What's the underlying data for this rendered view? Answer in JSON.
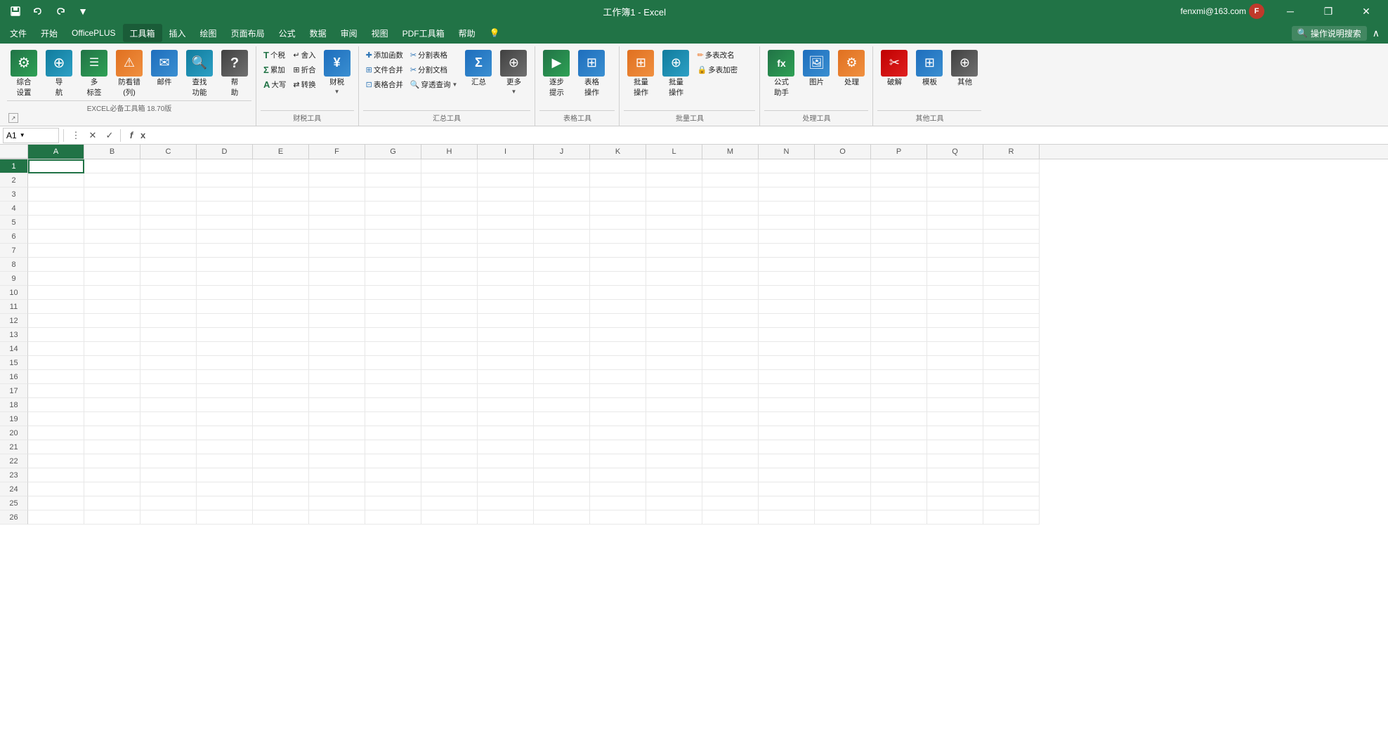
{
  "titleBar": {
    "title": "工作簿1 - Excel",
    "userEmail": "fenxmi@163.com",
    "userInitial": "F",
    "qatButtons": [
      "save",
      "undo",
      "redo",
      "customize"
    ],
    "windowButtons": [
      "minimize",
      "restore",
      "close"
    ]
  },
  "menuBar": {
    "items": [
      "文件",
      "开始",
      "OfficePLUS",
      "工具箱",
      "插入",
      "绘图",
      "页面布局",
      "公式",
      "数据",
      "审阅",
      "视图",
      "PDF工具箱",
      "帮助"
    ],
    "activeItem": "工具箱",
    "searchPlaceholder": "操作说明搜索"
  },
  "ribbon": {
    "groups": [
      {
        "label": "EXCEL必备工具箱 18.70版",
        "items": [
          {
            "type": "large",
            "icon": "⚙",
            "label": "综合\n设置",
            "color": "green"
          },
          {
            "type": "large",
            "icon": "⊕",
            "label": "导\n航",
            "color": "blue"
          },
          {
            "type": "large",
            "icon": "☰",
            "label": "多\n标签",
            "color": "orange"
          },
          {
            "type": "large",
            "icon": "⚠",
            "label": "防看错\n(列)",
            "color": "green"
          },
          {
            "type": "large",
            "icon": "✉",
            "label": "邮件",
            "color": "blue"
          },
          {
            "type": "large",
            "icon": "🔍",
            "label": "查找\n功能",
            "color": "teal"
          },
          {
            "type": "large",
            "icon": "?",
            "label": "帮\n助",
            "color": "gray"
          }
        ]
      },
      {
        "label": "财税工具",
        "items": [
          {
            "type": "small",
            "icon": "T",
            "label": "个税"
          },
          {
            "type": "small",
            "icon": "Σ",
            "label": "累加"
          },
          {
            "type": "small",
            "icon": "A",
            "label": "大写"
          },
          {
            "type": "small",
            "icon": "↵",
            "label": "舍入"
          },
          {
            "type": "small",
            "icon": "⊞",
            "label": "折合"
          },
          {
            "type": "small",
            "icon": "⇄",
            "label": "转换"
          },
          {
            "type": "large",
            "icon": "¥",
            "label": "财税",
            "color": "blue"
          }
        ]
      },
      {
        "label": "汇总工具",
        "items": [
          {
            "type": "small",
            "icon": "✚",
            "label": "添加函数"
          },
          {
            "type": "small",
            "icon": "✂",
            "label": "分割表格"
          },
          {
            "type": "small",
            "icon": "⊞",
            "label": "文件合并"
          },
          {
            "type": "small",
            "icon": "✂",
            "label": "分割文档"
          },
          {
            "type": "small",
            "icon": "⊡",
            "label": "表格合并"
          },
          {
            "type": "small",
            "icon": "🔍",
            "label": "穿透查询"
          },
          {
            "type": "large",
            "icon": "Σ",
            "label": "汇总",
            "color": "blue"
          },
          {
            "type": "large",
            "icon": "⊕",
            "label": "更多",
            "color": "gray"
          }
        ]
      },
      {
        "label": "表格工具",
        "items": [
          {
            "type": "large",
            "icon": "▶",
            "label": "逐步\n提示",
            "color": "green"
          },
          {
            "type": "large",
            "icon": "⊞",
            "label": "表格\n操作",
            "color": "blue"
          }
        ]
      },
      {
        "label": "批量工具",
        "items": [
          {
            "type": "large",
            "icon": "⊞",
            "label": "批量\n操作",
            "color": "orange"
          },
          {
            "type": "large",
            "icon": "⊕",
            "label": "批量\n操作",
            "color": "teal"
          },
          {
            "type": "small",
            "icon": "✏",
            "label": "多表改名"
          },
          {
            "type": "small",
            "icon": "⊞",
            "label": "多表加密"
          }
        ]
      },
      {
        "label": "处理工具",
        "items": [
          {
            "type": "large",
            "icon": "fx",
            "label": "公式\n助手",
            "color": "green"
          },
          {
            "type": "large",
            "icon": "🖼",
            "label": "图片",
            "color": "blue"
          },
          {
            "type": "large",
            "icon": "⚙",
            "label": "处理",
            "color": "orange"
          }
        ]
      },
      {
        "label": "其他工具",
        "items": [
          {
            "type": "large",
            "icon": "✂",
            "label": "破解",
            "color": "red"
          },
          {
            "type": "large",
            "icon": "⊞",
            "label": "模板",
            "color": "blue"
          },
          {
            "type": "large",
            "icon": "⊕",
            "label": "其他",
            "color": "gray"
          }
        ]
      }
    ]
  },
  "formulaBar": {
    "cellName": "A1",
    "cancelBtn": "✕",
    "confirmBtn": "✓",
    "functionBtn": "f",
    "formula": ""
  },
  "spreadsheet": {
    "columns": [
      "A",
      "B",
      "C",
      "D",
      "E",
      "F",
      "G",
      "H",
      "I",
      "J",
      "K",
      "L",
      "M",
      "N",
      "O",
      "P",
      "Q",
      "R"
    ],
    "rows": 26,
    "activeCell": "A1"
  }
}
